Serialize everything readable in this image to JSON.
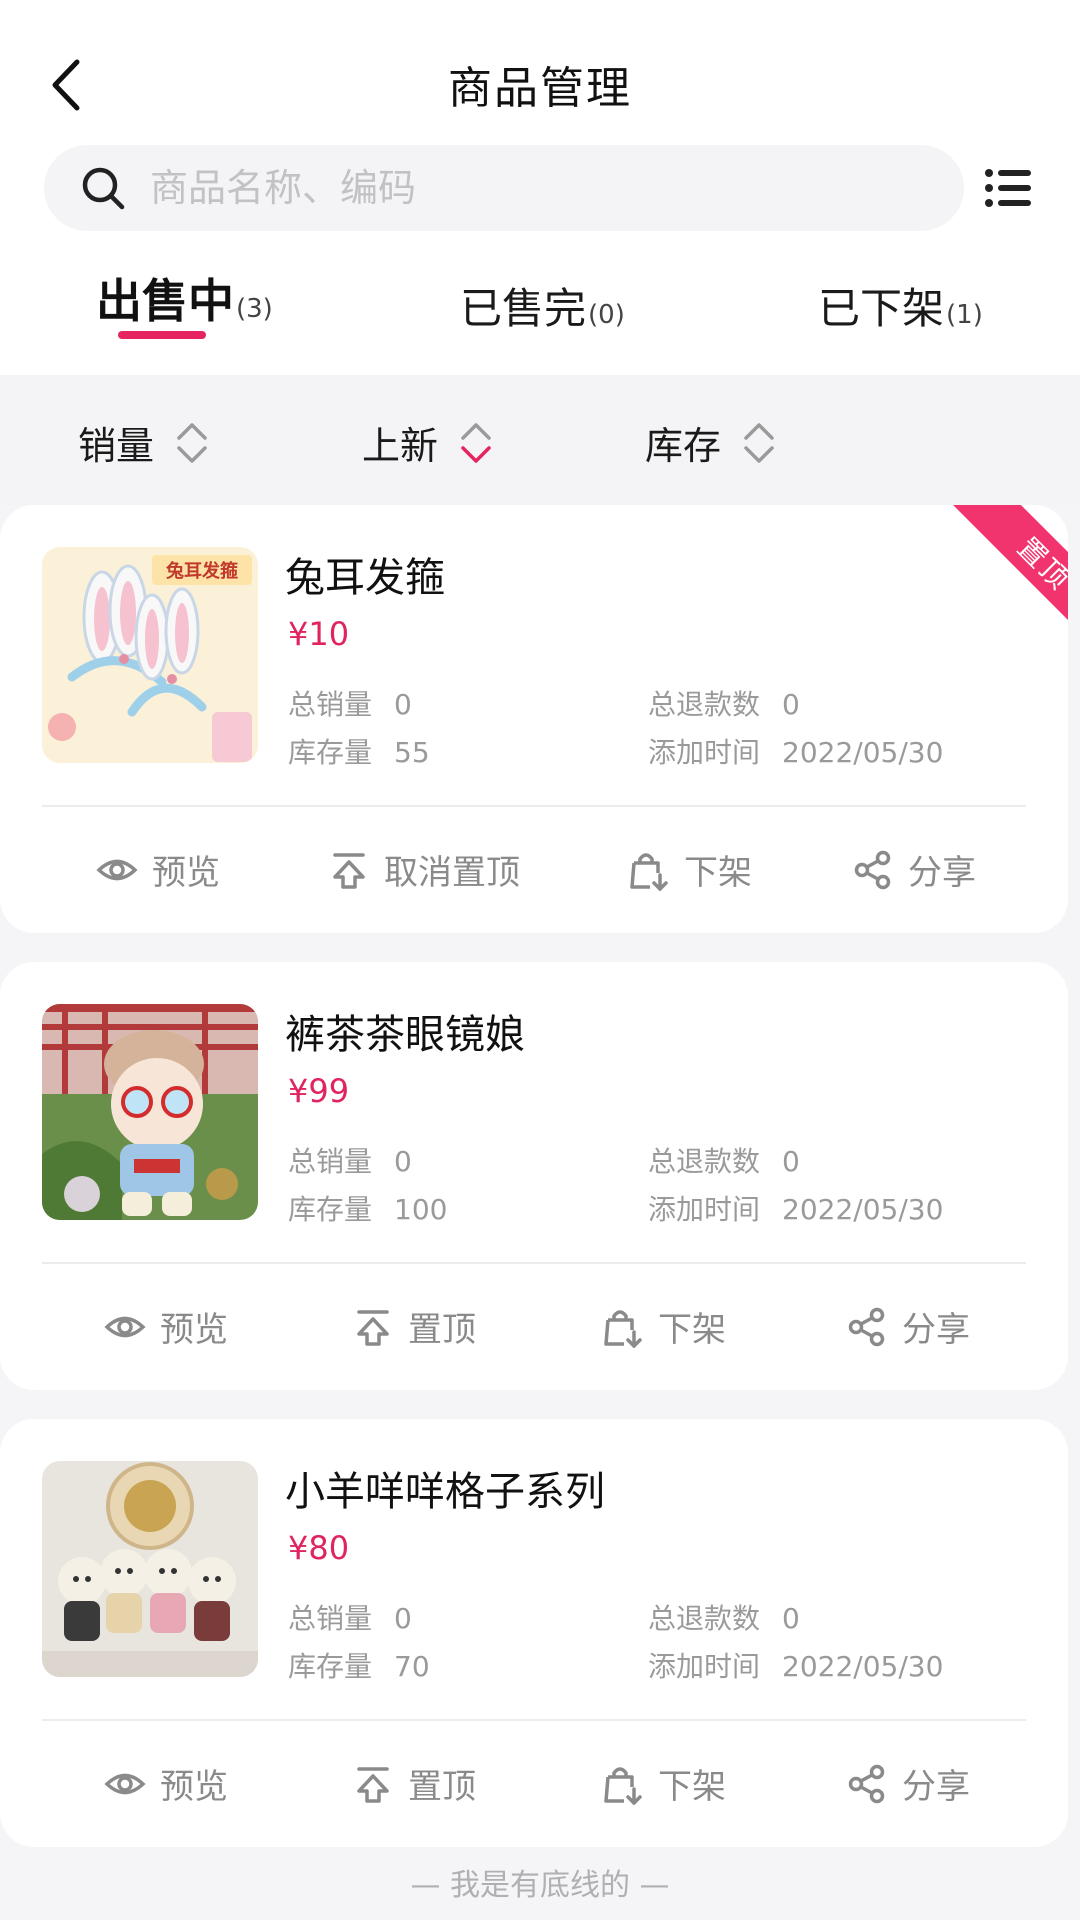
{
  "header": {
    "title": "商品管理",
    "search_placeholder": "商品名称、编码"
  },
  "tabs": [
    {
      "label": "出售中",
      "count": "(3)",
      "active": true
    },
    {
      "label": "已售完",
      "count": "(0)",
      "active": false
    },
    {
      "label": "已下架",
      "count": "(1)",
      "active": false
    }
  ],
  "sort": [
    {
      "label": "销量",
      "state": "none"
    },
    {
      "label": "上新",
      "state": "desc"
    },
    {
      "label": "库存",
      "state": "none"
    }
  ],
  "stat_labels": {
    "total_sales": "总销量",
    "stock": "库存量",
    "total_refunds": "总退款数",
    "added_time": "添加时间"
  },
  "products": [
    {
      "name": "兔耳发箍",
      "price": "¥10",
      "total_sales": "0",
      "stock": "55",
      "total_refunds": "0",
      "added_time": "2022/05/30",
      "pinned": true,
      "pin_badge": "置顶",
      "image_text": "兔耳发箍",
      "actions": [
        "预览",
        "取消置顶",
        "下架",
        "分享"
      ]
    },
    {
      "name": "裤茶茶眼镜娘",
      "price": "¥99",
      "total_sales": "0",
      "stock": "100",
      "total_refunds": "0",
      "added_time": "2022/05/30",
      "pinned": false,
      "actions": [
        "预览",
        "置顶",
        "下架",
        "分享"
      ]
    },
    {
      "name": "小羊咩咩格子系列",
      "price": "¥80",
      "total_sales": "0",
      "stock": "70",
      "total_refunds": "0",
      "added_time": "2022/05/30",
      "pinned": false,
      "actions": [
        "预览",
        "置顶",
        "下架",
        "分享"
      ]
    }
  ],
  "footer_hint": "— 我是有底线的 —",
  "colors": {
    "accent": "#e6245f",
    "price": "#e0245e",
    "muted": "#9a9a9a"
  }
}
